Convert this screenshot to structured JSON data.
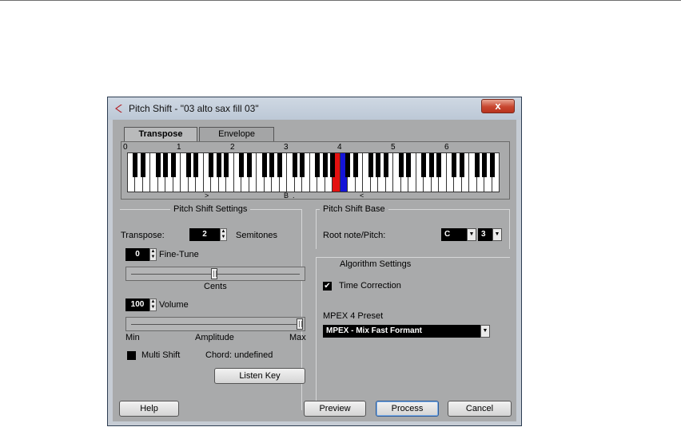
{
  "window": {
    "title": "Pitch Shift - \"03 alto sax fill 03\"",
    "close_label": "x"
  },
  "tabs": [
    {
      "label": "Transpose",
      "active": true
    },
    {
      "label": "Envelope",
      "active": false
    }
  ],
  "keyboard": {
    "octave_labels": [
      "0",
      "1",
      "2",
      "3",
      "4",
      "5",
      "6"
    ],
    "root_marker": "B",
    "colors": {
      "root": "#e31010",
      "target": "#1414d8"
    }
  },
  "pitch_shift_settings": {
    "title": "Pitch Shift Settings",
    "transpose_label": "Transpose:",
    "transpose_value": "2",
    "semitones_label": "Semitones",
    "fine_tune_value": "0",
    "fine_tune_label": "Fine-Tune",
    "cents_label": "Cents",
    "volume_value": "100",
    "volume_label": "Volume",
    "amplitude_min": "Min",
    "amplitude_label": "Amplitude",
    "amplitude_max": "Max",
    "multi_shift_label": "Multi Shift",
    "multi_shift_checked": false,
    "chord_text": "Chord: undefined",
    "listen_key_label": "Listen Key"
  },
  "pitch_shift_base": {
    "title": "Pitch Shift Base",
    "root_label": "Root note/Pitch:",
    "root_note": "C",
    "octave": "3"
  },
  "algorithm_settings": {
    "title": "Algorithm Settings",
    "time_correction_label": "Time Correction",
    "time_correction_checked": true,
    "preset_label": "MPEX 4 Preset",
    "preset_value": "MPEX - Mix Fast Formant"
  },
  "buttons": {
    "help": "Help",
    "preview": "Preview",
    "process": "Process",
    "cancel": "Cancel"
  }
}
